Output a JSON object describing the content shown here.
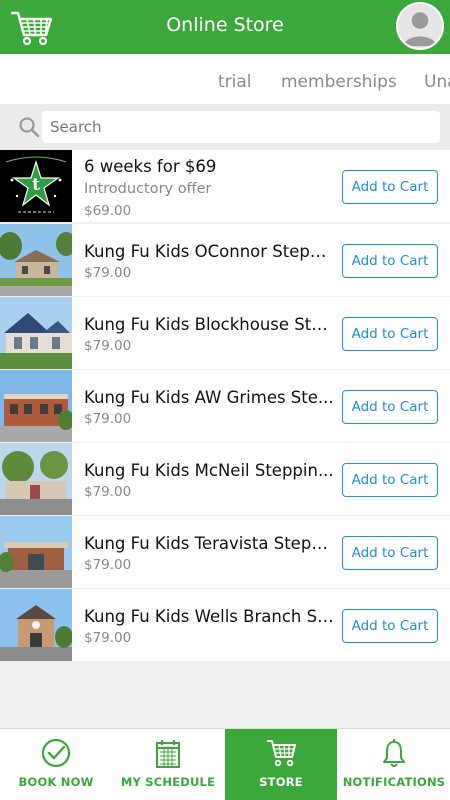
{
  "header": {
    "title": "Online Store",
    "cart_icon": "shopping-cart-icon",
    "avatar_icon": "user-avatar-icon"
  },
  "tabs": [
    "trial",
    "memberships",
    "Una"
  ],
  "search": {
    "placeholder": "Search",
    "value": ""
  },
  "products": [
    {
      "name": "6 weeks for $69",
      "subtitle": "Introductory offer",
      "price": "$69.00",
      "button": "Add to Cart",
      "logo_text": "Seven Star Martial Arts"
    },
    {
      "name": "Kung Fu Kids OConnor Steppin...",
      "price": "$79.00",
      "button": "Add to Cart"
    },
    {
      "name": "Kung Fu Kids Blockhouse Ste...",
      "price": "$79.00",
      "button": "Add to Cart"
    },
    {
      "name": "Kung Fu Kids AW Grimes Ste...",
      "price": "$79.00",
      "button": "Add to Cart"
    },
    {
      "name": "Kung Fu Kids McNeil Steppin...",
      "price": "$79.00",
      "button": "Add to Cart"
    },
    {
      "name": "Kung Fu Kids Teravista Stepp...",
      "price": "$79.00",
      "button": "Add to Cart"
    },
    {
      "name": "Kung Fu Kids Wells Branch St...",
      "price": "$79.00",
      "button": "Add to Cart"
    }
  ],
  "bottom_nav": [
    {
      "label": "BOOK NOW",
      "icon": "checkmark-circle-icon",
      "active": false
    },
    {
      "label": "MY SCHEDULE",
      "icon": "calendar-icon",
      "active": false
    },
    {
      "label": "STORE",
      "icon": "shopping-cart-icon",
      "active": true
    },
    {
      "label": "NOTIFICATIONS",
      "icon": "bell-icon",
      "active": false
    }
  ],
  "colors": {
    "brand_green": "#3ca73a",
    "button_blue": "#1f8fd8"
  }
}
